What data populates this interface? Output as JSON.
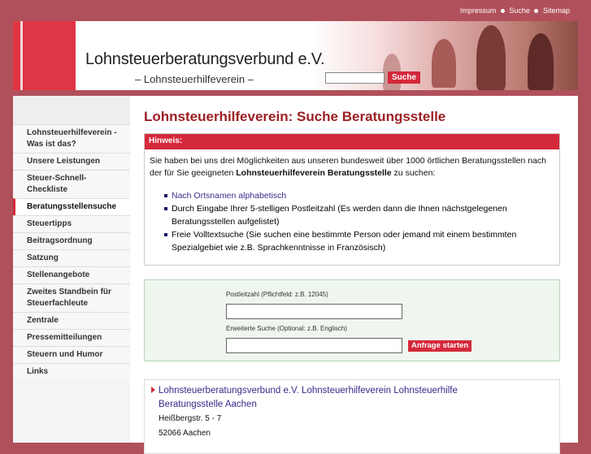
{
  "topnav": {
    "impressum": "Impressum",
    "suche": "Suche",
    "sitemap": "Sitemap"
  },
  "header": {
    "title": "Lohnsteuerberatungsverbund e.V.",
    "subtitle": "– Lohnsteuerhilfeverein –",
    "search_button": "Suche",
    "search_value": ""
  },
  "sidebar": {
    "items": [
      {
        "label": "Lohnsteuerhilfeverein - Was ist das?"
      },
      {
        "label": "Unsere Leistungen"
      },
      {
        "label": "Steuer-Schnell-Checkliste"
      },
      {
        "label": "Beratungsstellensuche",
        "active": true
      },
      {
        "label": "Steuertipps"
      },
      {
        "label": "Beitragsordnung"
      },
      {
        "label": "Satzung"
      },
      {
        "label": "Stellenangebote"
      },
      {
        "label": "Zweites Standbein für Steuerfachleute"
      },
      {
        "label": "Zentrale"
      },
      {
        "label": "Pressemitteilungen"
      },
      {
        "label": "Steuern und Humor"
      },
      {
        "label": "Links"
      }
    ]
  },
  "main": {
    "title": "Lohnsteuerhilfeverein: Suche Beratungsstelle",
    "hint_heading": "Hinweis:",
    "hint_text_before": "Sie haben bei uns drei Möglichkeiten aus unseren bundesweit über 1000 örtlichen Beratungsstellen nach der für Sie geeigneten ",
    "hint_text_bold": "Lohnsteuerhilfeverein Beratungsstelle",
    "hint_text_after": " zu suchen:",
    "options": [
      "Nach Ortsnamen alphabetisch",
      "Durch Eingabe Ihrer 5-stelligen Postleitzahl (Es werden dann die Ihnen nächstgelegenen Beratungsstellen aufgelistet)",
      "Freie Volltextsuche (Sie suchen eine bestimmte Person oder jemand mit einem bestimmten Spezialgebiet wie z.B. Sprachkenntnisse in Französisch)"
    ]
  },
  "form": {
    "plz_label": "Postleitzahl (Pflichtfeld: z.B. 12045)",
    "plz_value": "",
    "ext_label": "Erweiterte Suche (Optional: z.B. Englisch)",
    "ext_value": "",
    "submit_label": "Anfrage starten"
  },
  "result": {
    "link_text": "Lohnsteuerberatungsverbund e.V. Lohnsteuerhilfeverein Lohnsteuerhilfe Beratungsstelle Aachen",
    "street": "Heißbergstr. 5 - 7",
    "city": "52066 Aachen"
  },
  "colors": {
    "brand_red": "#d4293a",
    "background": "#b0505b",
    "title_red": "#9c1f24"
  }
}
